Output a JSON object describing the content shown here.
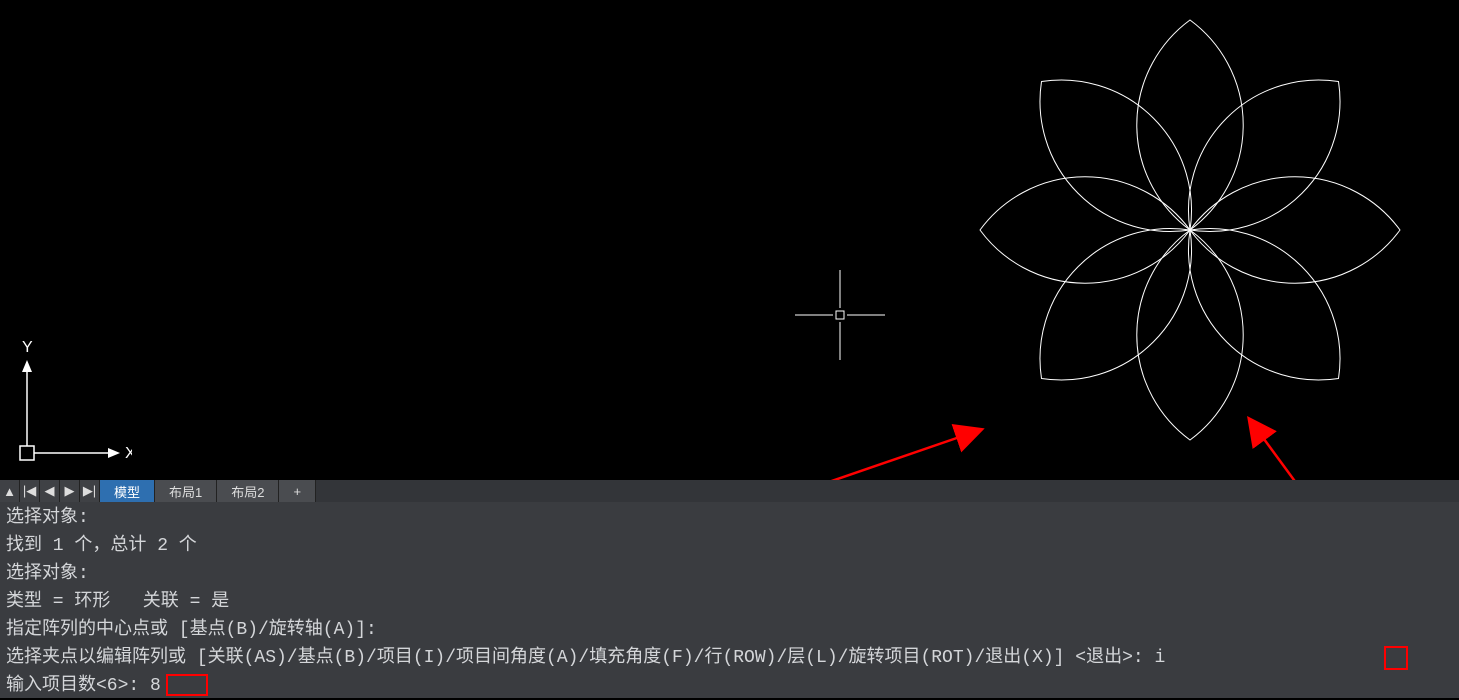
{
  "ucs": {
    "x_label": "X",
    "y_label": "Y"
  },
  "tabs": {
    "model": "模型",
    "layout1": "布局1",
    "layout2": "布局2",
    "add": "+"
  },
  "history": {
    "line1": "选择对象:",
    "line2": "找到 1 个，总计 2 个",
    "line3": "选择对象:",
    "line4": "类型 = 环形   关联 = 是",
    "line5": "指定阵列的中心点或 [基点(B)/旋转轴(A)]:",
    "line6": "选择夹点以编辑阵列或 [关联(AS)/基点(B)/项目(I)/项目间角度(A)/填充角度(F)/行(ROW)/层(L)/旋转项目(ROT)/退出(X)] <退出>: i",
    "line7": "输入项目数<6>: 8"
  },
  "chart_data": {
    "type": "polar-array",
    "items": 8,
    "base_angle_deg": 0,
    "fill_angle_deg": 360,
    "associative": true,
    "array_type": "环形"
  }
}
